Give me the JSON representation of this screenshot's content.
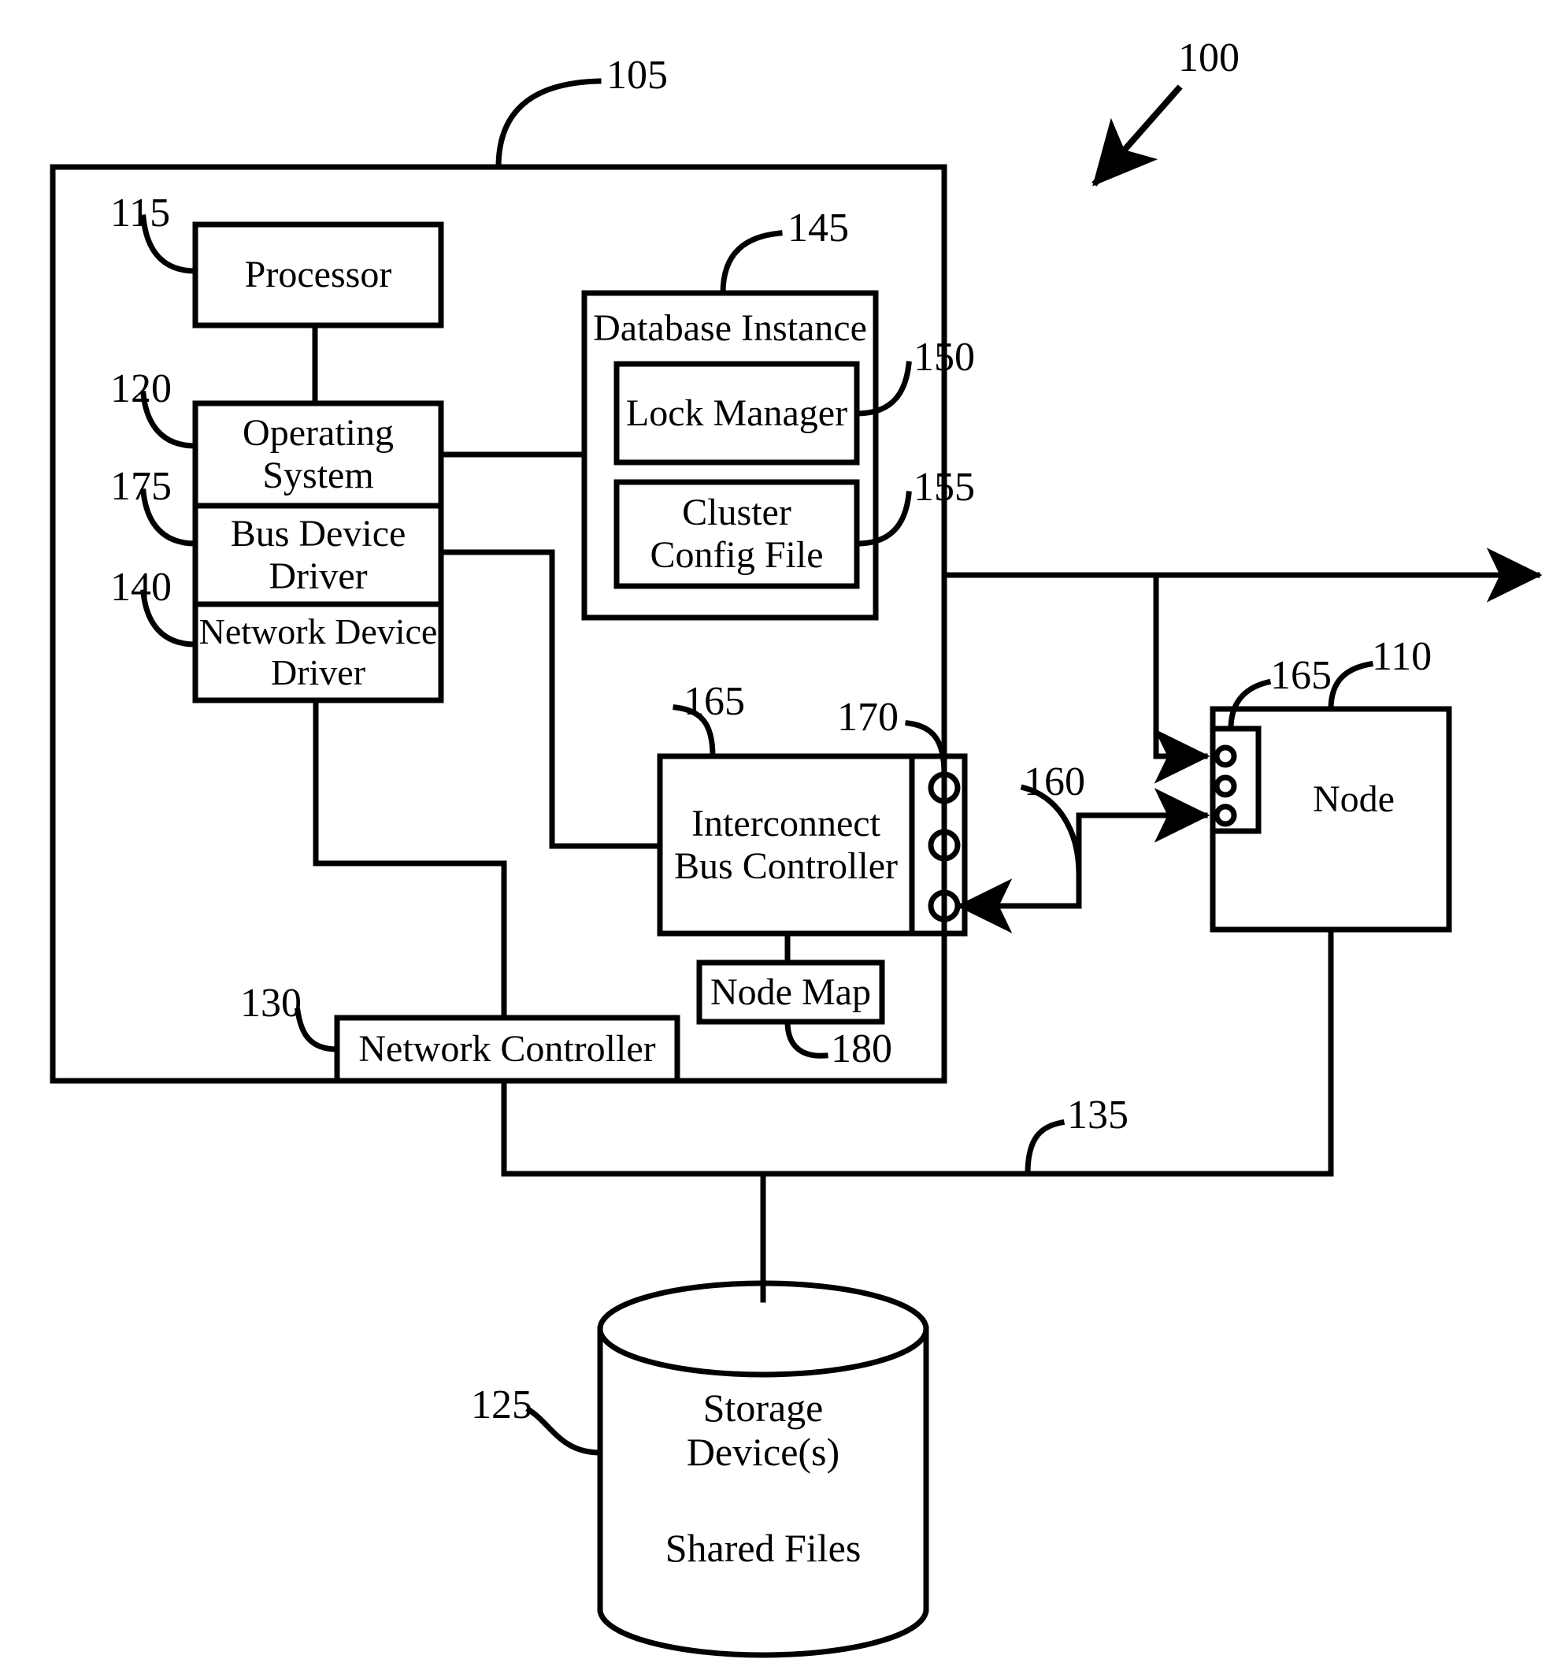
{
  "figure": {
    "type": "patent-block-diagram",
    "system_ref": "100"
  },
  "refs": {
    "system": "100",
    "computing_device": "105",
    "node": "110",
    "processor": "115",
    "operating_system": "120",
    "storage_devices": "125",
    "network_controller": "130",
    "network": "135",
    "network_device_driver": "140",
    "database_instance": "145",
    "lock_manager": "150",
    "cluster_config_file": "155",
    "interconnect_link": "160",
    "interconnect_port_block": "165",
    "ports": "170",
    "bus_device_driver": "175",
    "node_map": "180"
  },
  "blocks": {
    "processor": "Processor",
    "operating_system": "Operating\nSystem",
    "bus_device_driver": "Bus Device\nDriver",
    "network_device_driver": "Network Device\nDriver",
    "database_instance": "Database Instance",
    "lock_manager": "Lock Manager",
    "cluster_config_file": "Cluster\nConfig File",
    "interconnect_bus_controller": "Interconnect\nBus Controller",
    "node_map": "Node Map",
    "network_controller": "Network Controller",
    "node": "Node",
    "storage_device": "Storage\nDevice(s)",
    "shared_files": "Shared Files"
  },
  "colors": {
    "ink": "#000000",
    "paper": "#ffffff"
  }
}
